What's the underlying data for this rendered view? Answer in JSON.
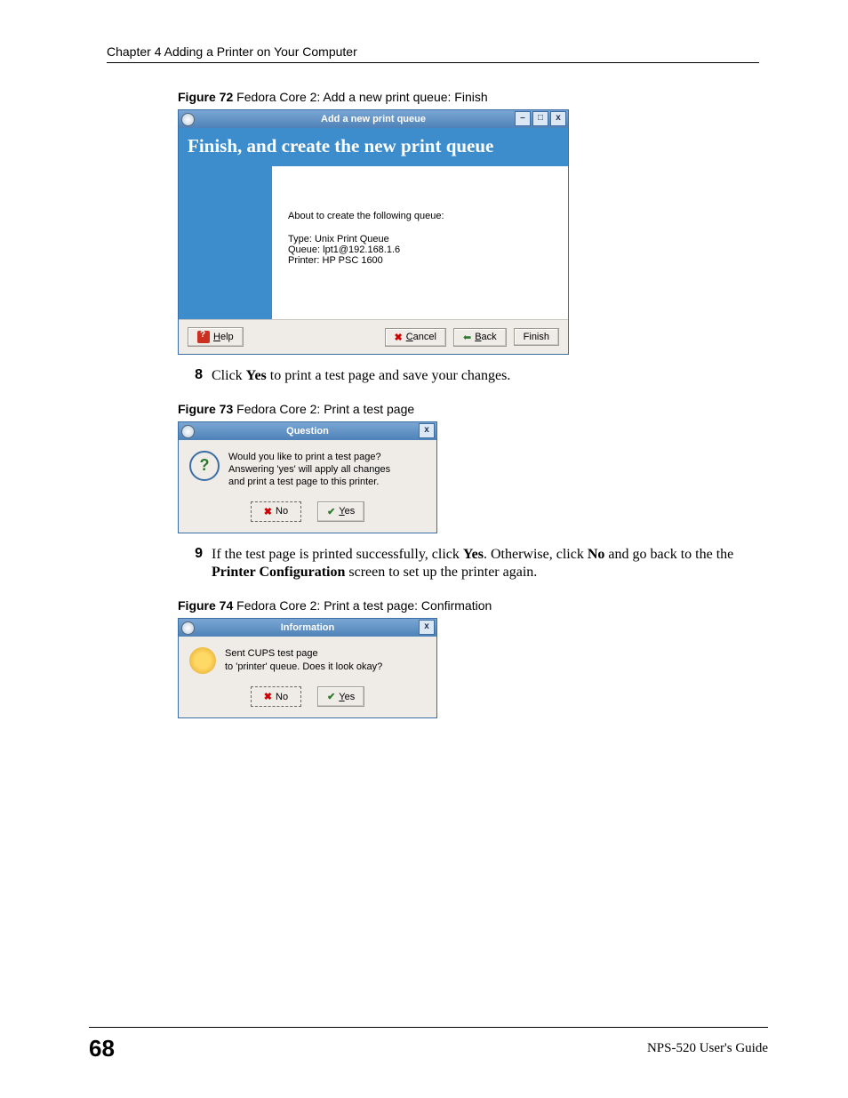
{
  "header": "Chapter 4 Adding a Printer on Your Computer",
  "fig72": {
    "caption_label": "Figure 72",
    "caption_text": "   Fedora Core 2: Add a new print queue: Finish",
    "title": "Add a new print queue",
    "banner": "Finish, and create the new print queue",
    "msg": "About to create the following queue:",
    "type": "Type: Unix Print Queue",
    "queue": "Queue: lpt1@192.168.1.6",
    "printer": "Printer: HP PSC 1600",
    "help": "Help",
    "cancel": "Cancel",
    "back": "Back",
    "finish": "Finish"
  },
  "step8": {
    "num": "8",
    "pre": "Click ",
    "yes": "Yes",
    "post": " to print a test page and save your changes."
  },
  "fig73": {
    "caption_label": "Figure 73",
    "caption_text": "   Fedora Core 2: Print a test page",
    "title": "Question",
    "line1": "Would you like to print a test page?",
    "line2": "Answering 'yes' will apply all changes",
    "line3": "and print a test page to this printer.",
    "no": "No",
    "yes": "Yes"
  },
  "step9": {
    "num": "9",
    "pre": "If the test page is printed successfully, click ",
    "yes": "Yes",
    "mid": ". Otherwise, click ",
    "no": "No",
    "post1": " and go back to the the ",
    "pc": "Printer Configuration",
    "post2": " screen to set up the printer again."
  },
  "fig74": {
    "caption_label": "Figure 74",
    "caption_text": "   Fedora Core 2: Print a test page: Confirmation",
    "title": "Information",
    "line1": "Sent CUPS test page",
    "line2": "to 'printer' queue.  Does it look okay?",
    "no": "No",
    "yes": "Yes"
  },
  "footer": {
    "page": "68",
    "guide": "NPS-520 User's Guide"
  }
}
